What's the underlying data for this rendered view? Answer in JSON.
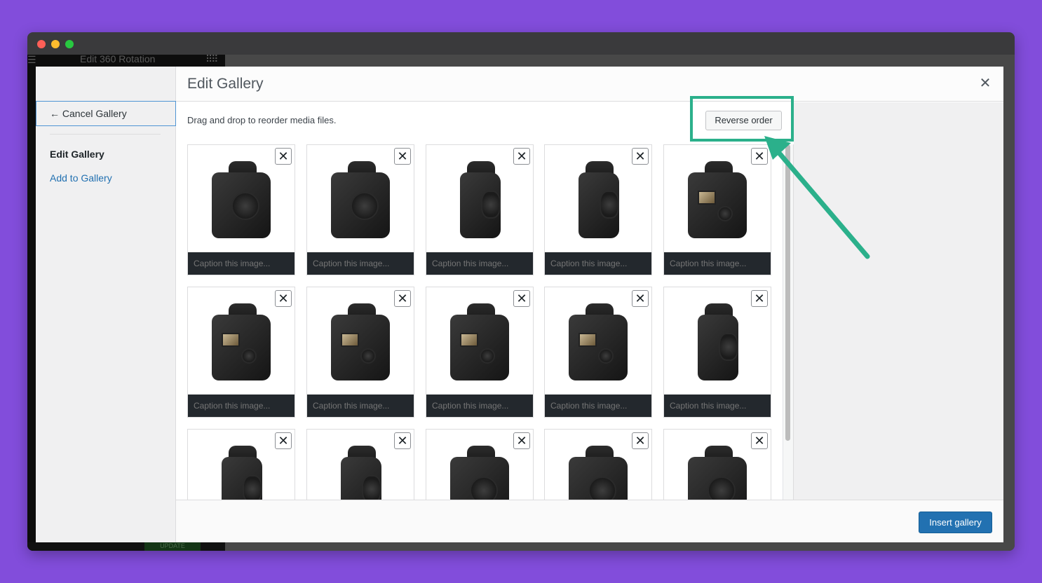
{
  "window": {
    "background_app_title": "Edit 360 Rotation",
    "background_update_label": "UPDATE"
  },
  "sidebar": {
    "cancel_label": "← Cancel Gallery",
    "items": [
      {
        "label": "Edit Gallery",
        "active": true
      },
      {
        "label": "Add to Gallery",
        "active": false
      }
    ]
  },
  "header": {
    "title": "Edit Gallery",
    "close_icon": "close-icon"
  },
  "content": {
    "instructions": "Drag and drop to reorder media files.",
    "reverse_order_label": "Reverse order",
    "caption_placeholder": "Caption this image...",
    "remove_icon": "✕",
    "images": [
      {
        "view": "front"
      },
      {
        "view": "front"
      },
      {
        "view": "side"
      },
      {
        "view": "side"
      },
      {
        "view": "back"
      },
      {
        "view": "back"
      },
      {
        "view": "back"
      },
      {
        "view": "back"
      },
      {
        "view": "back"
      },
      {
        "view": "side"
      },
      {
        "view": "side"
      },
      {
        "view": "side"
      },
      {
        "view": "front"
      },
      {
        "view": "front"
      },
      {
        "view": "front"
      }
    ]
  },
  "footer": {
    "insert_label": "Insert gallery"
  },
  "annotation": {
    "color": "#2bb08b",
    "target": "Reverse order"
  },
  "colors": {
    "page_bg": "#824ddb",
    "primary": "#2271b1",
    "caption_bg": "#23282d"
  }
}
